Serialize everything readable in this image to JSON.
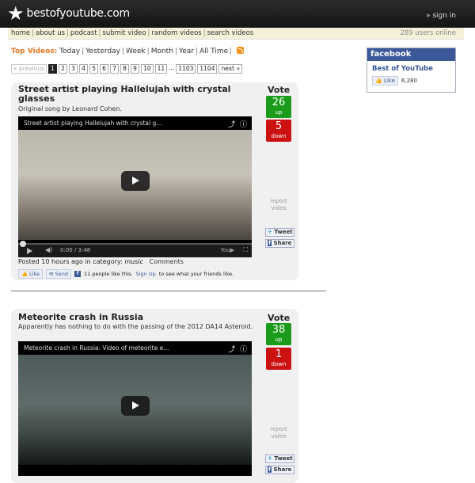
{
  "site": {
    "logo_text": "bestofyoutube.com",
    "signin": "» sign in"
  },
  "nav": {
    "links": [
      "home",
      "about us",
      "podcast",
      "submit video",
      "random videos",
      "search videos"
    ],
    "users_online": "289 users online"
  },
  "top_videos": {
    "label": "Top Videos:",
    "periods": [
      "Today",
      "Yesterday",
      "Week",
      "Month",
      "Year",
      "All Time"
    ]
  },
  "pager": {
    "previous": "« previous",
    "pages": [
      "1",
      "2",
      "3",
      "4",
      "5",
      "6",
      "7",
      "8",
      "9",
      "10",
      "11"
    ],
    "ellipsis": "...",
    "far_pages": [
      "1103",
      "1104"
    ],
    "next": "next »",
    "current": "1"
  },
  "facebook": {
    "header": "facebook",
    "page_name": "Best of YouTube",
    "like": "Like",
    "count": "6,280"
  },
  "videos": [
    {
      "title": "Street artist playing Hallelujah with crystal glasses",
      "subtitle": "Original song by Leonard Cohen.",
      "player_title": "Street artist playing Hallelujah with crystal g...",
      "time": "0:00 / 3:48",
      "vote_label": "Vote",
      "up": "26",
      "up_word": "up",
      "down": "5",
      "down_word": "down",
      "report": "report video",
      "tweet": "Tweet",
      "share": "Share",
      "posted": "Posted 10 hours ago in category:",
      "category": "music",
      "comments": "Comments",
      "like": "Like",
      "send": "Send",
      "social_text": "11 people like this.",
      "signup": "Sign Up",
      "signup_tail": "to see what your friends like."
    },
    {
      "title": "Meteorite crash in Russia",
      "subtitle": "Apparently has nothing to do with the passing of the 2012 DA14 Asteroid.",
      "player_title": "Meteorite crash in Russia: Video of meteorite e...",
      "vote_label": "Vote",
      "up": "38",
      "up_word": "up",
      "down": "1",
      "down_word": "down",
      "report": "report video",
      "tweet": "Tweet",
      "share": "Share"
    }
  ],
  "icons": {
    "logo": "star-icon",
    "share": "share-icon",
    "info": "info-icon",
    "rss": "rss-icon"
  },
  "colors": {
    "vote_up": "#1a9b1a",
    "vote_down": "#cc1111",
    "accent": "#e87722",
    "facebook": "#3b5998"
  }
}
